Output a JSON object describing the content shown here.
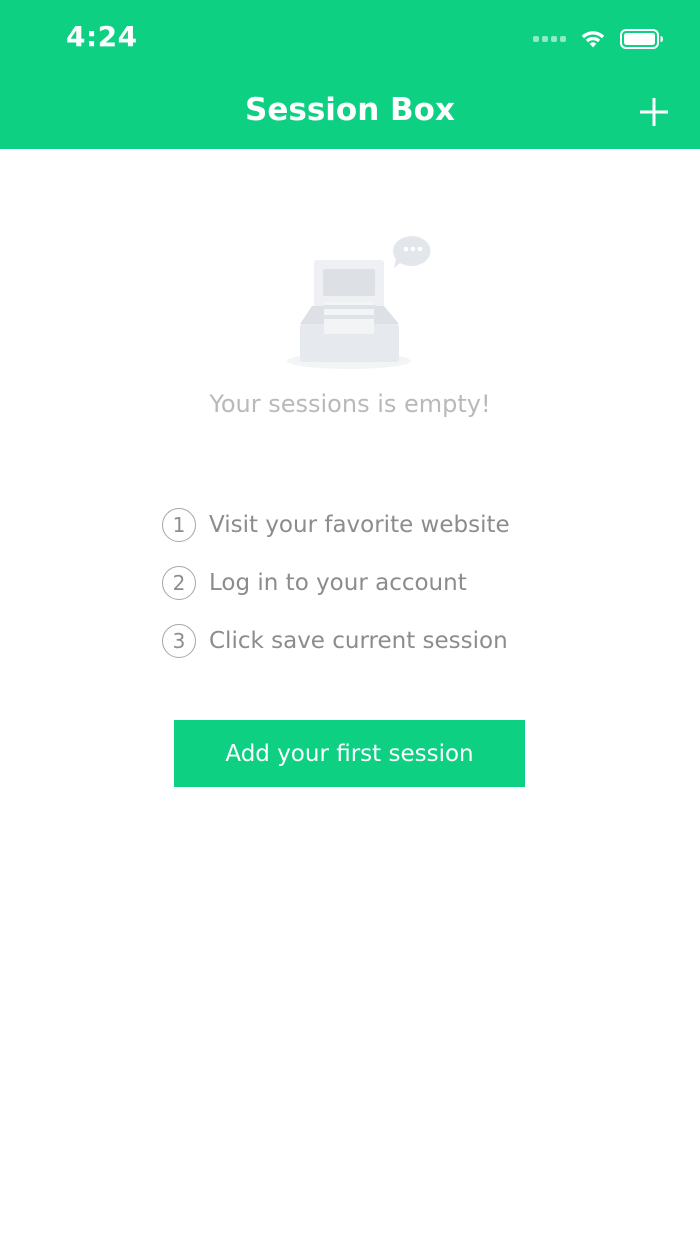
{
  "status_bar": {
    "time": "4:24"
  },
  "header": {
    "title": "Session Box",
    "add_icon": "plus-icon"
  },
  "empty_state": {
    "illustration": "empty-inbox-illustration",
    "message": "Your sessions is empty!"
  },
  "steps": [
    {
      "number": "1",
      "text": "Visit your favorite website"
    },
    {
      "number": "2",
      "text": "Log in to your account"
    },
    {
      "number": "3",
      "text": "Click save current session"
    }
  ],
  "cta": {
    "label": "Add your first session"
  },
  "colors": {
    "brand_green": "#0dd083",
    "muted_text": "#b9b9b9",
    "step_text": "#8c8c8c"
  }
}
